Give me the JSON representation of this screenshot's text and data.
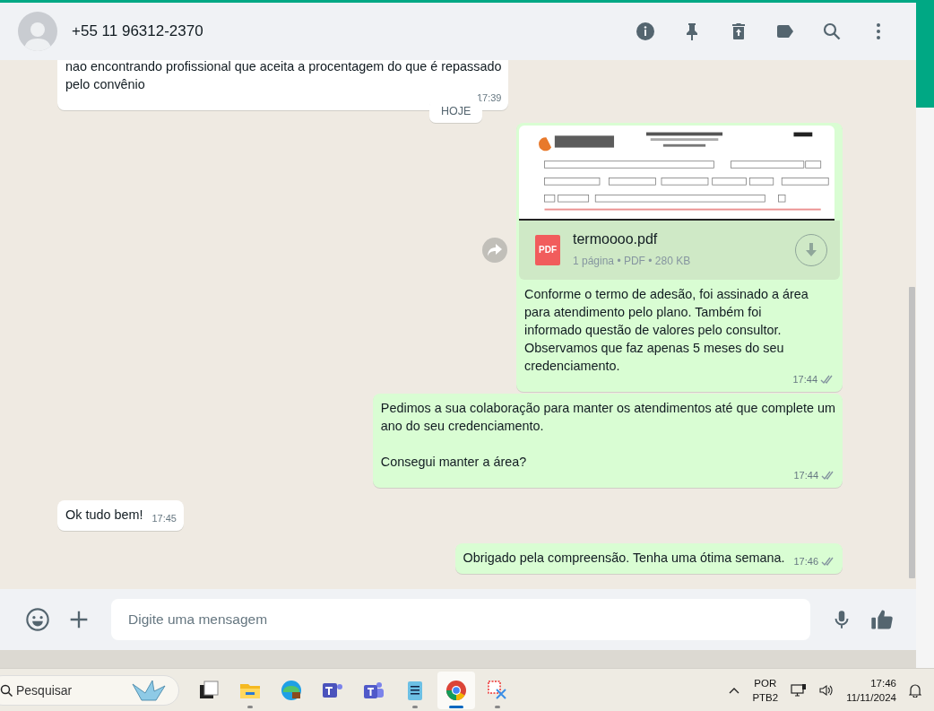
{
  "header": {
    "contact": "+55 11 96312-2370"
  },
  "date_badge": "HOJE",
  "messages": [
    {
      "kind": "text",
      "outgoing": false,
      "text": "nao encontrando profissional que aceita a procentagem do que é repassado\npelo convênio",
      "time": "17:39"
    },
    {
      "kind": "document",
      "outgoing": true,
      "file_name": "termoooo.pdf",
      "file_icon": "PDF",
      "file_info": "1 página • PDF • 280 KB",
      "text": "Conforme o termo de adesão, foi assinado a área\npara atendimento pelo plano. Também foi\ninformado questão de valores pelo consultor.\nObservamos que faz apenas 5 meses do seu\ncredenciamento.",
      "time": "17:44",
      "read": false
    },
    {
      "kind": "text",
      "outgoing": true,
      "text": "Pedimos a sua colaboração para manter os atendimentos até que complete um\nano do seu credenciamento.\n\nConsegui manter a área?",
      "time": "17:44",
      "read": false
    },
    {
      "kind": "text",
      "outgoing": false,
      "text": "Ok tudo bem!",
      "time": "17:45"
    },
    {
      "kind": "text",
      "outgoing": true,
      "text": "Obrigado pela compreensão. Tenha uma ótima semana.",
      "time": "17:46",
      "read": false
    }
  ],
  "composer": {
    "placeholder": "Digite uma mensagem"
  },
  "taskbar": {
    "search": {
      "placeholder": "Pesquisar"
    },
    "apps": [
      {
        "kind": "taskview",
        "running": false,
        "selected": false
      },
      {
        "kind": "explorer",
        "running": true,
        "selected": false
      },
      {
        "kind": "edge",
        "running": false,
        "selected": false
      },
      {
        "kind": "teams",
        "running": false,
        "selected": false
      },
      {
        "kind": "teams2",
        "running": false,
        "selected": false
      },
      {
        "kind": "notepad",
        "running": true,
        "selected": false
      },
      {
        "kind": "chrome",
        "running": true,
        "selected": true
      },
      {
        "kind": "snip",
        "running": true,
        "selected": false
      }
    ],
    "language": [
      "POR",
      "PTB2"
    ],
    "time": "17:46",
    "date": "11/11/2024"
  }
}
